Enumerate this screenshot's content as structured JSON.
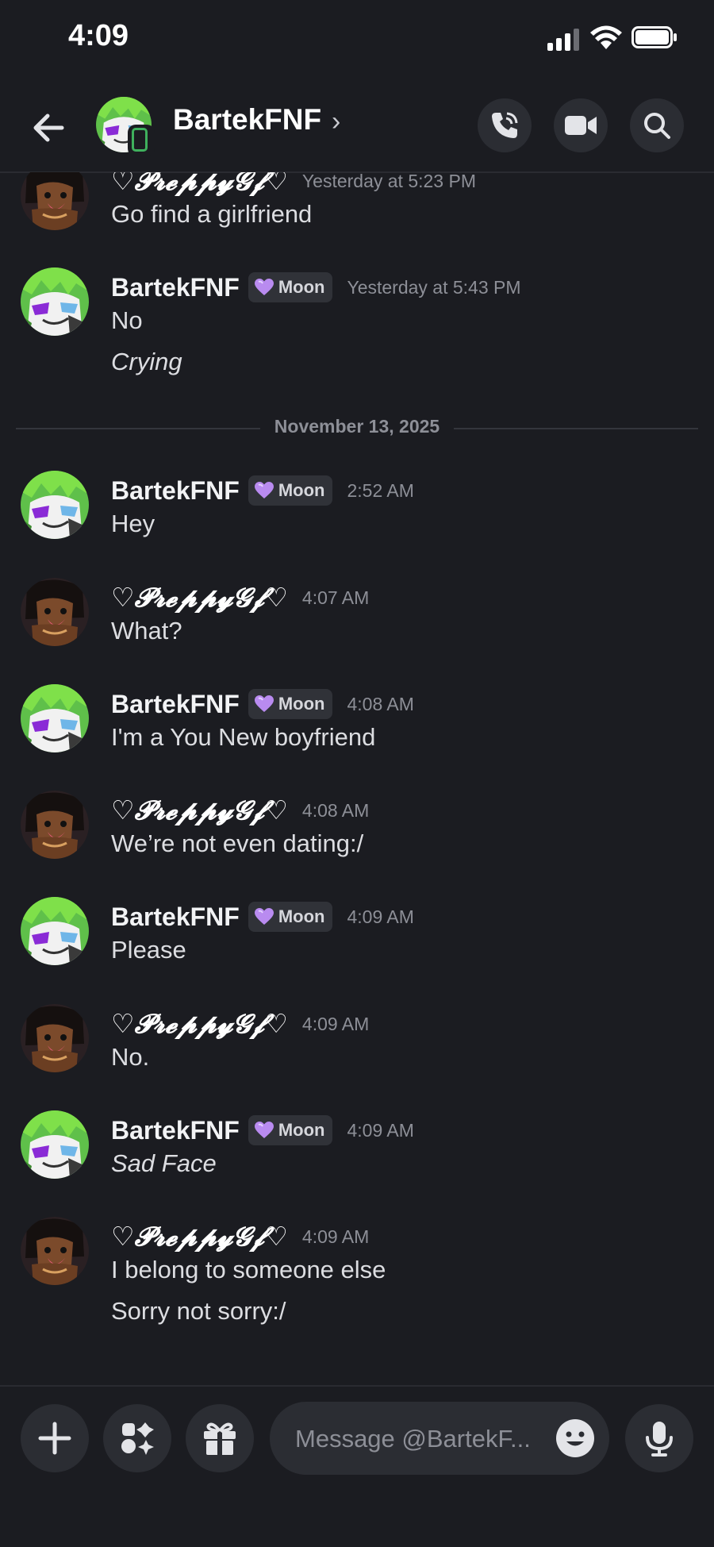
{
  "status_bar": {
    "time": "4:09"
  },
  "header": {
    "title": "BartekFNF",
    "chevron": "›"
  },
  "messages": [
    {
      "user": "♡𝓟𝓻𝓮𝓹𝓹𝔂𝓖𝓯♡",
      "time": "Yesterday at 5:23 PM",
      "lines": [
        "Go find a girlfriend"
      ]
    },
    {
      "user": "BartekFNF",
      "badge": "Moon",
      "time": "Yesterday at 5:43 PM",
      "lines": [
        "No",
        "Crying"
      ]
    },
    {
      "user": "BartekFNF",
      "badge": "Moon",
      "time": "2:52 AM",
      "lines": [
        "Hey"
      ]
    },
    {
      "user": "♡𝓟𝓻𝓮𝓹𝓹𝔂𝓖𝓯♡",
      "time": "4:07 AM",
      "lines": [
        "What?"
      ]
    },
    {
      "user": "BartekFNF",
      "badge": "Moon",
      "time": "4:08 AM",
      "lines": [
        "I'm a You New boyfriend"
      ]
    },
    {
      "user": "♡𝓟𝓻𝓮𝓹𝓹𝔂𝓖𝓯♡",
      "time": "4:08 AM",
      "lines": [
        "We’re not even dating:/"
      ]
    },
    {
      "user": "BartekFNF",
      "badge": "Moon",
      "time": "4:09 AM",
      "lines": [
        "Please"
      ]
    },
    {
      "user": "♡𝓟𝓻𝓮𝓹𝓹𝔂𝓖𝓯♡",
      "time": "4:09 AM",
      "lines": [
        "No."
      ]
    },
    {
      "user": "BartekFNF",
      "badge": "Moon",
      "time": "4:09 AM",
      "lines": [
        "Sad Face"
      ]
    },
    {
      "user": "♡𝓟𝓻𝓮𝓹𝓹𝔂𝓖𝓯♡",
      "time": "4:09 AM",
      "lines": [
        "I belong to someone else",
        "Sorry not sorry:/"
      ]
    }
  ],
  "date_divider": "November 13, 2025",
  "composer": {
    "placeholder": "Message @BartekF..."
  },
  "icons": {
    "back": "back-arrow-icon",
    "voice_call": "phone-call-icon",
    "video_call": "video-camera-icon",
    "search": "search-icon",
    "add": "plus-icon",
    "apps": "apps-icon",
    "gift": "gift-icon",
    "emoji": "emoji-icon",
    "mic": "microphone-icon",
    "device": "mobile-phone-icon",
    "nitro_badge": "heart-icon"
  },
  "colors": {
    "background": "#1b1c21",
    "online_mobile": "#3fb05d",
    "badge_heart": "#b98bf0"
  }
}
